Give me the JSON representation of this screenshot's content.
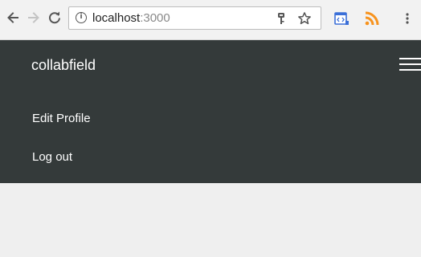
{
  "browser": {
    "url_host": "localhost",
    "url_port": ":3000",
    "icons": {
      "back": "arrow-left-icon",
      "forward": "arrow-right-icon",
      "reload": "reload-icon",
      "site_info": "info-icon",
      "info_glyph": "i",
      "key": "key-icon",
      "bookmark": "star-icon",
      "devtools_extension": "devtools-icon",
      "rss_extension": "rss-icon",
      "menu": "vertical-dots-icon"
    },
    "colors": {
      "toolbar_bg": "#f2f2f2",
      "rss_orange": "#f7931e",
      "devtools_blue": "#3b6fd8"
    }
  },
  "navbar": {
    "brand": "collabfield",
    "links": [
      {
        "label": "Edit Profile"
      },
      {
        "label": "Log out"
      }
    ],
    "toggle_icon": "hamburger-menu-icon",
    "colors": {
      "background": "#343a3a",
      "text": "#ffffff"
    }
  },
  "page": {
    "background": "#efefef"
  }
}
